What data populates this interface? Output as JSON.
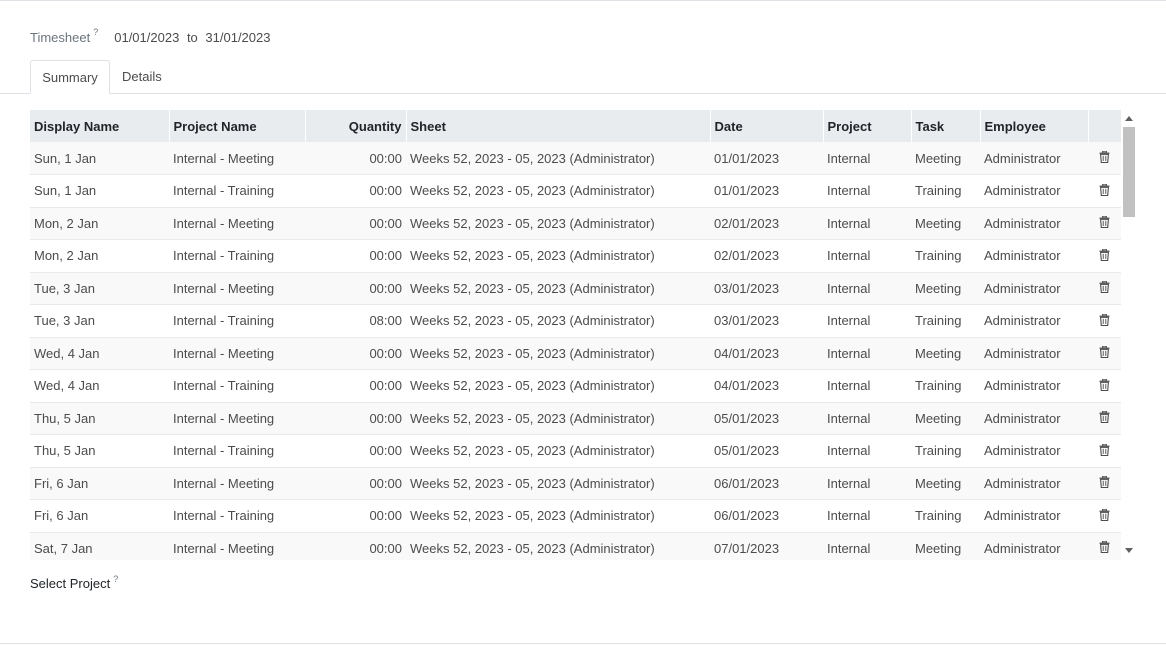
{
  "timesheet": {
    "label": "Timesheet",
    "help": "?",
    "date_from": "01/01/2023",
    "date_sep": "to",
    "date_to": "31/01/2023"
  },
  "tabs": [
    {
      "label": "Summary",
      "active": true
    },
    {
      "label": "Details",
      "active": false
    }
  ],
  "table": {
    "columns": [
      "Display Name",
      "Project Name",
      "Quantity",
      "Sheet",
      "Date",
      "Project",
      "Task",
      "Employee"
    ],
    "rows": [
      {
        "display_name": "Sun, 1 Jan",
        "project_name": "Internal - Meeting",
        "quantity": "00:00",
        "sheet": "Weeks 52, 2023 - 05, 2023 (Administrator)",
        "date": "01/01/2023",
        "project": "Internal",
        "task": "Meeting",
        "employee": "Administrator"
      },
      {
        "display_name": "Sun, 1 Jan",
        "project_name": "Internal - Training",
        "quantity": "00:00",
        "sheet": "Weeks 52, 2023 - 05, 2023 (Administrator)",
        "date": "01/01/2023",
        "project": "Internal",
        "task": "Training",
        "employee": "Administrator"
      },
      {
        "display_name": "Mon, 2 Jan",
        "project_name": "Internal - Meeting",
        "quantity": "00:00",
        "sheet": "Weeks 52, 2023 - 05, 2023 (Administrator)",
        "date": "02/01/2023",
        "project": "Internal",
        "task": "Meeting",
        "employee": "Administrator"
      },
      {
        "display_name": "Mon, 2 Jan",
        "project_name": "Internal - Training",
        "quantity": "00:00",
        "sheet": "Weeks 52, 2023 - 05, 2023 (Administrator)",
        "date": "02/01/2023",
        "project": "Internal",
        "task": "Training",
        "employee": "Administrator"
      },
      {
        "display_name": "Tue, 3 Jan",
        "project_name": "Internal - Meeting",
        "quantity": "00:00",
        "sheet": "Weeks 52, 2023 - 05, 2023 (Administrator)",
        "date": "03/01/2023",
        "project": "Internal",
        "task": "Meeting",
        "employee": "Administrator"
      },
      {
        "display_name": "Tue, 3 Jan",
        "project_name": "Internal - Training",
        "quantity": "08:00",
        "sheet": "Weeks 52, 2023 - 05, 2023 (Administrator)",
        "date": "03/01/2023",
        "project": "Internal",
        "task": "Training",
        "employee": "Administrator"
      },
      {
        "display_name": "Wed, 4 Jan",
        "project_name": "Internal - Meeting",
        "quantity": "00:00",
        "sheet": "Weeks 52, 2023 - 05, 2023 (Administrator)",
        "date": "04/01/2023",
        "project": "Internal",
        "task": "Meeting",
        "employee": "Administrator"
      },
      {
        "display_name": "Wed, 4 Jan",
        "project_name": "Internal - Training",
        "quantity": "00:00",
        "sheet": "Weeks 52, 2023 - 05, 2023 (Administrator)",
        "date": "04/01/2023",
        "project": "Internal",
        "task": "Training",
        "employee": "Administrator"
      },
      {
        "display_name": "Thu, 5 Jan",
        "project_name": "Internal - Meeting",
        "quantity": "00:00",
        "sheet": "Weeks 52, 2023 - 05, 2023 (Administrator)",
        "date": "05/01/2023",
        "project": "Internal",
        "task": "Meeting",
        "employee": "Administrator"
      },
      {
        "display_name": "Thu, 5 Jan",
        "project_name": "Internal - Training",
        "quantity": "00:00",
        "sheet": "Weeks 52, 2023 - 05, 2023 (Administrator)",
        "date": "05/01/2023",
        "project": "Internal",
        "task": "Training",
        "employee": "Administrator"
      },
      {
        "display_name": "Fri, 6 Jan",
        "project_name": "Internal - Meeting",
        "quantity": "00:00",
        "sheet": "Weeks 52, 2023 - 05, 2023 (Administrator)",
        "date": "06/01/2023",
        "project": "Internal",
        "task": "Meeting",
        "employee": "Administrator"
      },
      {
        "display_name": "Fri, 6 Jan",
        "project_name": "Internal - Training",
        "quantity": "00:00",
        "sheet": "Weeks 52, 2023 - 05, 2023 (Administrator)",
        "date": "06/01/2023",
        "project": "Internal",
        "task": "Training",
        "employee": "Administrator"
      },
      {
        "display_name": "Sat, 7 Jan",
        "project_name": "Internal - Meeting",
        "quantity": "00:00",
        "sheet": "Weeks 52, 2023 - 05, 2023 (Administrator)",
        "date": "07/01/2023",
        "project": "Internal",
        "task": "Meeting",
        "employee": "Administrator"
      }
    ],
    "row_action_icon": "trash-icon"
  },
  "select_project": {
    "label": "Select Project",
    "help": "?"
  },
  "colors": {
    "header_bg": "#e9ecef",
    "row_odd_bg": "#f9f9f9",
    "text": "#4c4c4c",
    "label": "#6c757d",
    "scroll_thumb": "#c1c1c1"
  }
}
